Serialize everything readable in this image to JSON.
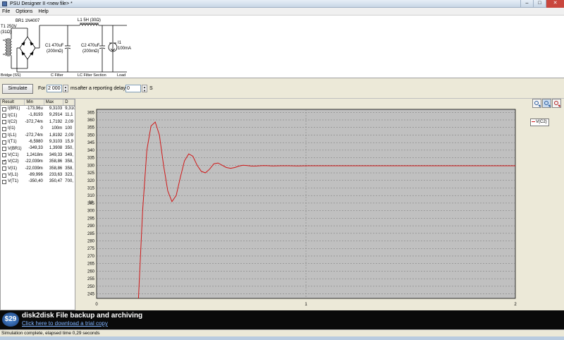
{
  "window": {
    "title": "PSU Designer II  <new file> *",
    "controls": [
      "–",
      "□",
      "✕"
    ]
  },
  "menu": [
    "File",
    "Options",
    "Help"
  ],
  "schematic": {
    "transformer": [
      "T1 250V",
      "(31Ω)"
    ],
    "bridge_label": "BR1 1N4007",
    "c1": [
      "C1 470uF",
      "(200mΩ)"
    ],
    "l1": "L1 5H (30Ω)",
    "c2": [
      "C2 470uF",
      "(200mΩ)"
    ],
    "load": [
      "I1",
      "100mA"
    ],
    "sections": [
      "Bridge (SS)",
      "C Filter",
      "LC Filter Section",
      "Load"
    ]
  },
  "simbar": {
    "simulate_label": "Simulate",
    "for_label": "For",
    "duration_value": "2 000",
    "duration_unit": "ms",
    "delay_label": "after a reporting delay of",
    "delay_value": "0",
    "delay_unit": "S"
  },
  "results": {
    "columns": [
      "Result",
      "Min",
      "Max",
      "D"
    ],
    "rows": [
      {
        "name": "I(BR1)",
        "min": "-173,96u",
        "max": "9,3103",
        "d": "9,310",
        "checked": false
      },
      {
        "name": "I(C1)",
        "min": "-1,8193",
        "max": "9,2914",
        "d": "11,1",
        "checked": false
      },
      {
        "name": "I(C2)",
        "min": "-372,74m",
        "max": "1,7192",
        "d": "2,09",
        "checked": false
      },
      {
        "name": "I(I1)",
        "min": "0",
        "max": "100m",
        "d": "100",
        "checked": false
      },
      {
        "name": "I(L1)",
        "min": "-272,74m",
        "max": "1,8192",
        "d": "2,09",
        "checked": false
      },
      {
        "name": "I(T1)",
        "min": "-6,5980",
        "max": "9,3103",
        "d": "15,9",
        "checked": false
      },
      {
        "name": "V(BR1)",
        "min": "-349,33",
        "max": "1,3908",
        "d": "350,",
        "checked": false
      },
      {
        "name": "V(C1)",
        "min": "1,2418m",
        "max": "349,33",
        "d": "349,",
        "checked": false
      },
      {
        "name": "V(C2)",
        "min": "-22,039m",
        "max": "358,86",
        "d": "358,",
        "checked": true
      },
      {
        "name": "V(I1)",
        "min": "-22,039m",
        "max": "358,86",
        "d": "358,",
        "checked": false
      },
      {
        "name": "V(L1)",
        "min": "-89,996",
        "max": "233,63",
        "d": "323,",
        "checked": false
      },
      {
        "name": "V(T1)",
        "min": "-350,40",
        "max": "350,47",
        "d": "700,",
        "checked": false
      }
    ]
  },
  "chart_data": {
    "type": "line",
    "ylabel": "V",
    "xlim": [
      0,
      2
    ],
    "ylim": [
      242,
      367
    ],
    "xticks": [
      "0",
      "1",
      "2"
    ],
    "yticks": [
      245,
      250,
      255,
      260,
      265,
      270,
      275,
      280,
      285,
      290,
      295,
      300,
      305,
      310,
      315,
      320,
      325,
      330,
      335,
      340,
      345,
      350,
      355,
      360,
      365
    ],
    "grid": true,
    "legend_position": "top-right",
    "series": [
      {
        "name": "V(C2)",
        "color": "#d01818",
        "x": [
          0.2,
          0.22,
          0.24,
          0.26,
          0.28,
          0.3,
          0.32,
          0.34,
          0.36,
          0.38,
          0.4,
          0.42,
          0.44,
          0.46,
          0.48,
          0.5,
          0.52,
          0.54,
          0.56,
          0.58,
          0.6,
          0.62,
          0.64,
          0.66,
          0.68,
          0.7,
          0.72,
          0.74,
          0.76,
          0.78,
          0.8,
          0.84,
          0.88,
          0.92,
          0.96,
          1.0,
          1.2,
          1.4,
          1.6,
          1.8,
          2.0
        ],
        "values": [
          242,
          300,
          340,
          356,
          358.6,
          350,
          330,
          313,
          306,
          310,
          322,
          333,
          337.5,
          336,
          330,
          326,
          325,
          327.5,
          331,
          331.5,
          330,
          328.5,
          328,
          328.5,
          329.5,
          330,
          329.8,
          329.5,
          329.5,
          329.7,
          329.8,
          329.6,
          329.7,
          329.7,
          329.6,
          329.7,
          329.7,
          329.7,
          329.7,
          329.7,
          329.7
        ]
      }
    ]
  },
  "zoom_icons": [
    "zoom-in-icon",
    "zoom-fit-icon",
    "zoom-out-icon"
  ],
  "banner": {
    "price": "$29",
    "title": "disk2disk File backup and archiving",
    "link": "Click here to download a trial copy"
  },
  "status": "Simulation complete, elapsed time 0,29 seconds"
}
